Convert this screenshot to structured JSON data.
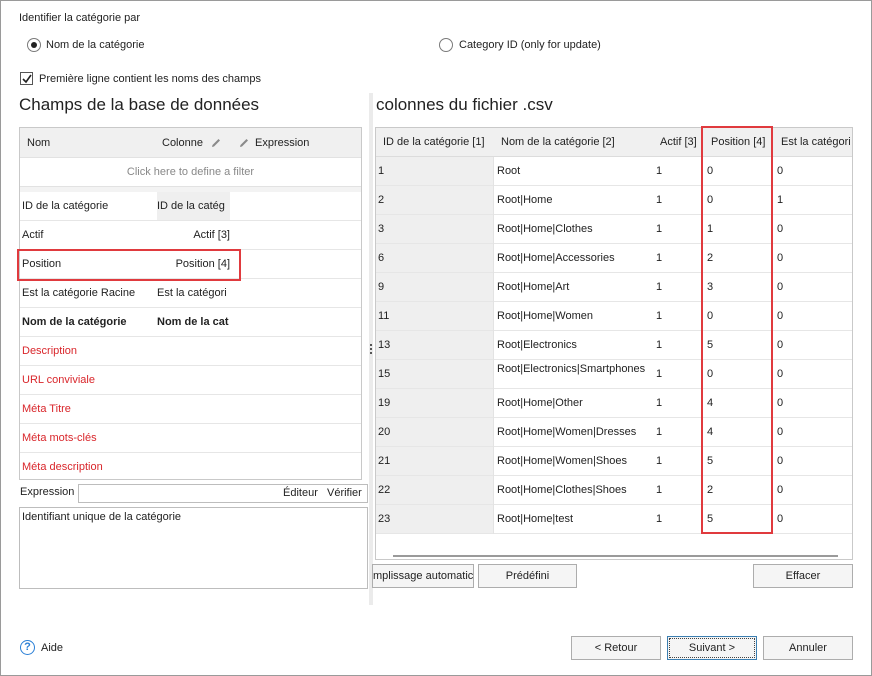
{
  "identify": {
    "title": "Identifier la catégorie par",
    "option_name": "Nom de la catégorie",
    "option_id": "Category ID (only for update)",
    "selected": "option_name"
  },
  "first_line_checkbox": {
    "label": "Première ligne contient les noms des champs",
    "checked": true
  },
  "left_panel": {
    "title": "Champs de la base de données",
    "headers": {
      "name": "Nom",
      "column": "Colonne",
      "expression": "Expression"
    },
    "filter_text": "Click here to define a filter",
    "rows": [
      {
        "name": "ID de la catégorie",
        "column": "ID de la catég",
        "style": "normal"
      },
      {
        "name": "Actif",
        "column": "Actif [3]",
        "style": "normal"
      },
      {
        "name": "Position",
        "column": "Position [4]",
        "style": "normal"
      },
      {
        "name": "Est la catégorie Racine",
        "column": "Est la catégori",
        "style": "normal"
      },
      {
        "name": "Nom de la catégorie",
        "column": "Nom de la cat",
        "style": "bold"
      },
      {
        "name": "Description",
        "column": "",
        "style": "red"
      },
      {
        "name": "URL conviviale",
        "column": "",
        "style": "red"
      },
      {
        "name": "Méta Titre",
        "column": "",
        "style": "red"
      },
      {
        "name": "Méta mots-clés",
        "column": "",
        "style": "red"
      },
      {
        "name": "Méta description",
        "column": "",
        "style": "red"
      }
    ],
    "expression_label": "Expression",
    "editor_button": "Éditeur",
    "verify_button": "Vérifier",
    "description_text": "Identifiant unique de la catégorie"
  },
  "right_panel": {
    "title": "colonnes du fichier .csv",
    "headers": [
      "ID de la catégorie [1]",
      "Nom de la catégorie [2]",
      "Actif [3]",
      "Position [4]",
      "Est la catégori"
    ],
    "rows": [
      [
        "1",
        "Root",
        "1",
        "0",
        "0"
      ],
      [
        "2",
        "Root|Home",
        "1",
        "0",
        "1"
      ],
      [
        "3",
        "Root|Home|Clothes",
        "1",
        "1",
        "0"
      ],
      [
        "6",
        "Root|Home|Accessories",
        "1",
        "2",
        "0"
      ],
      [
        "9",
        "Root|Home|Art",
        "1",
        "3",
        "0"
      ],
      [
        "11",
        "Root|Home|Women",
        "1",
        "0",
        "0"
      ],
      [
        "13",
        "Root|Electronics",
        "1",
        "5",
        "0"
      ],
      [
        "15",
        "Root|Electronics|Smartphones",
        "1",
        "0",
        "0"
      ],
      [
        "19",
        "Root|Home|Other",
        "1",
        "4",
        "0"
      ],
      [
        "20",
        "Root|Home|Women|Dresses",
        "1",
        "4",
        "0"
      ],
      [
        "21",
        "Root|Home|Women|Shoes",
        "1",
        "5",
        "0"
      ],
      [
        "22",
        "Root|Home|Clothes|Shoes",
        "1",
        "2",
        "0"
      ],
      [
        "23",
        "Root|Home|test",
        "1",
        "5",
        "0"
      ]
    ],
    "autofill_button": "mplissage automatic",
    "predefined_button": "Prédéfini",
    "clear_button": "Effacer"
  },
  "footer": {
    "help_label": "Aide",
    "help_icon_glyph": "?",
    "back_button": "< Retour",
    "next_button": "Suivant >",
    "cancel_button": "Annuler"
  },
  "colors": {
    "highlight": "#e03a3e",
    "required_field": "#d9262b",
    "link_blue": "#2a7fd6"
  }
}
